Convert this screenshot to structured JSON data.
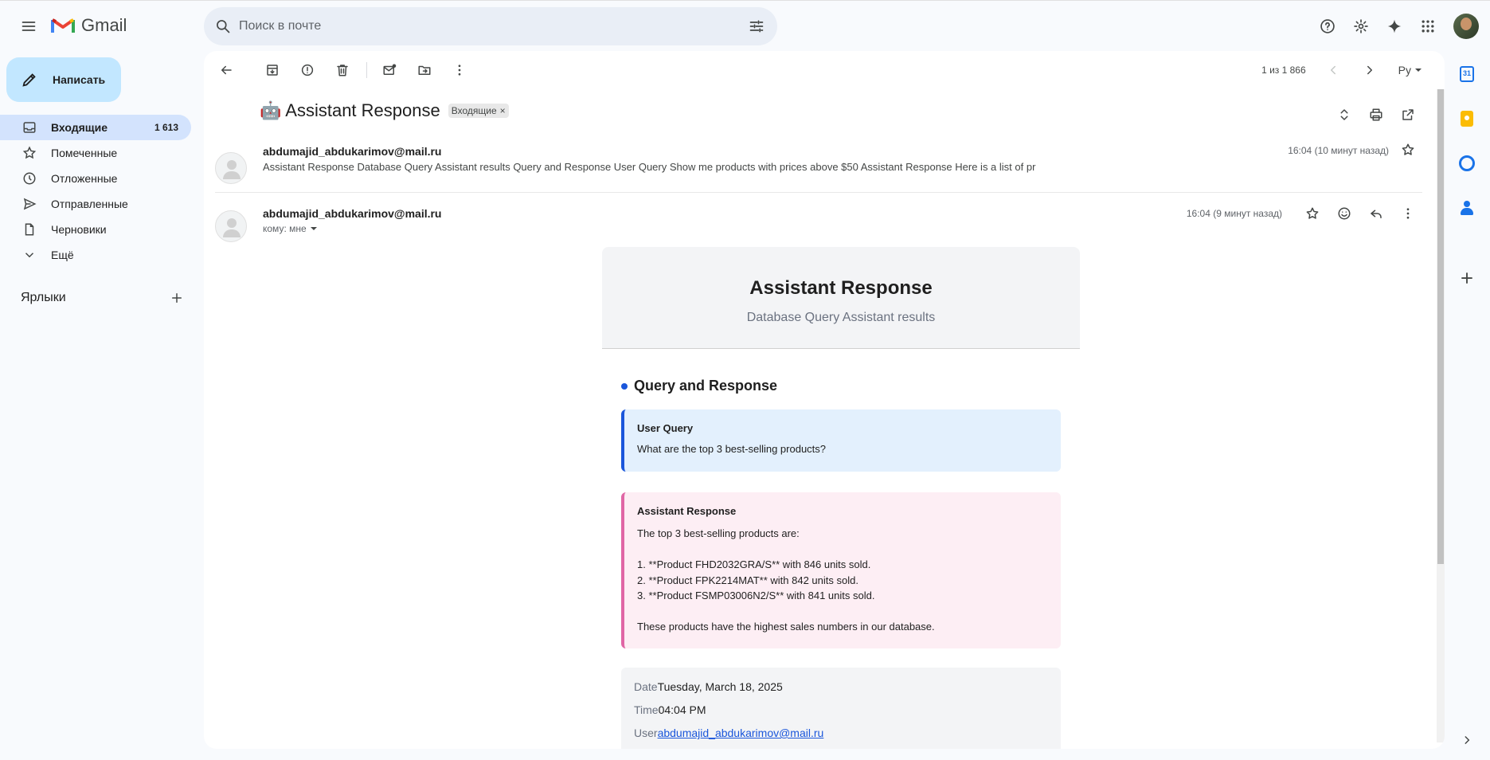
{
  "header": {
    "app_name": "Gmail",
    "search_placeholder": "Поиск в почте"
  },
  "compose_label": "Написать",
  "nav": {
    "inbox": {
      "label": "Входящие",
      "count": "1 613"
    },
    "starred": {
      "label": "Помеченные"
    },
    "snoozed": {
      "label": "Отложенные"
    },
    "sent": {
      "label": "Отправленные"
    },
    "drafts": {
      "label": "Черновики"
    },
    "more": {
      "label": "Ещё"
    }
  },
  "labels_title": "Ярлыки",
  "toolbar": {
    "pagination": "1 из 1 866",
    "language": "Ру"
  },
  "thread": {
    "subject": "🤖 Assistant Response",
    "chip": "Входящие",
    "chip_remove": "×"
  },
  "message_collapsed": {
    "sender": "abdumajid_abdukarimov@mail.ru",
    "snippet": "Assistant Response Database Query Assistant results Query and Response User Query Show me products with prices above $50 Assistant Response Here is a list of pr",
    "time": "16:04 (10 минут назад)"
  },
  "message_open": {
    "sender": "abdumajid_abdukarimov@mail.ru",
    "to": "кому: мне",
    "time": "16:04 (9 минут назад)"
  },
  "email_body": {
    "title": "Assistant Response",
    "subtitle": "Database Query Assistant results",
    "section_title": "Query and Response",
    "query_label": "User Query",
    "query_text": "What are the top 3 best-selling products?",
    "response_label": "Assistant Response",
    "response_lines": [
      "The top 3 best-selling products are:",
      "",
      "1. **Product FHD2032GRA/S** with 846 units sold.",
      "2. **Product FPK2214MAT** with 842 units sold.",
      "3. **Product FSMP03006N2/S** with 841 units sold.",
      "",
      "These products have the highest sales numbers in our database."
    ],
    "meta": {
      "date_key": "Date",
      "date_value": "Tuesday, March 18, 2025",
      "time_key": "Time",
      "time_value": "04:04 PM",
      "user_key": "User",
      "user_value": "abdumajid_abdukarimov@mail.ru"
    }
  },
  "side_panel": {
    "calendar_day": "31"
  },
  "colors": {
    "accent_blue": "#1a56db",
    "compose_bg": "#c2e7ff",
    "inbox_active_bg": "#d3e3fd",
    "query_box_bg": "#e3f0fd",
    "response_box_bg": "#fdeef4",
    "response_border": "#e066a5"
  }
}
